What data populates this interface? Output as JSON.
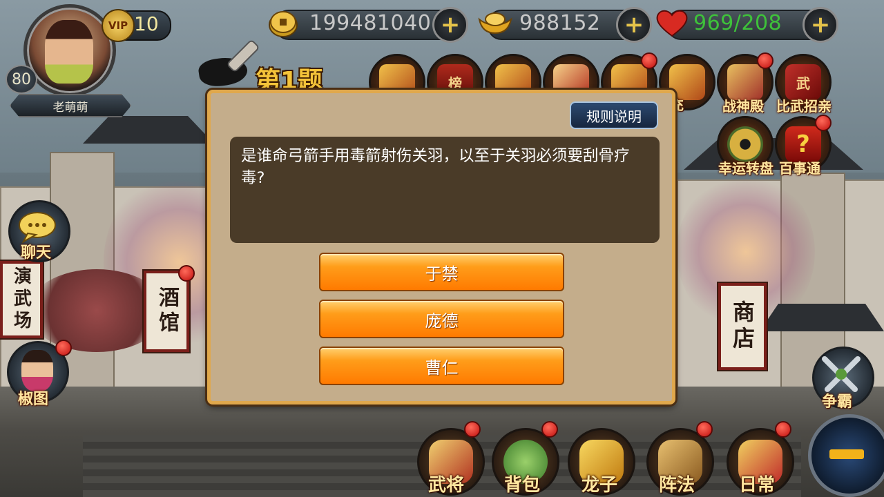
{
  "player": {
    "name": "老萌萌",
    "level": "80",
    "vip_label": "VIP",
    "vip_level": "10"
  },
  "resources": {
    "copper": "199481040",
    "gold": "988152",
    "stamina": "969/208",
    "stamina_color": "#3ec23a"
  },
  "feature_icons": [
    {
      "label": "",
      "icon": "treasure-pot-icon"
    },
    {
      "label": "",
      "icon": "ranking-icon",
      "glyph": "榜"
    },
    {
      "label": "",
      "icon": "scroll-icon"
    },
    {
      "label": "",
      "icon": "scroll-red-icon"
    },
    {
      "label": "",
      "icon": "treasure-chest-icon"
    },
    {
      "label": "充",
      "icon": "recharge-icon"
    },
    {
      "label": "战神殿",
      "icon": "war-god-hall-icon"
    },
    {
      "label": "比武招亲",
      "icon": "martial-contest-icon",
      "glyph": "武"
    },
    {
      "label": "幸运转盘",
      "icon": "lucky-wheel-icon"
    },
    {
      "label": "百事通",
      "icon": "question-mark-icon",
      "glyph": "?"
    }
  ],
  "side": {
    "chat": "聊天",
    "beauty": "椒图",
    "contend": "争霸"
  },
  "signs": {
    "arena": "演武场",
    "tavern": "酒馆",
    "shop": "商店"
  },
  "quiz": {
    "title": "第1题",
    "rules_button": "规则说明",
    "question": "是谁命弓箭手用毒箭射伤关羽，以至于关羽必须要刮骨疗毒?",
    "answers": [
      "于禁",
      "庞德",
      "曹仁"
    ]
  },
  "bottom_menu": [
    "武将",
    "背包",
    "龙子",
    "阵法",
    "日常"
  ],
  "colors": {
    "answer_button": "#ff8a00",
    "panel": "#c4ad8b",
    "title": "#f4c43a",
    "notification": "#c0100e"
  }
}
